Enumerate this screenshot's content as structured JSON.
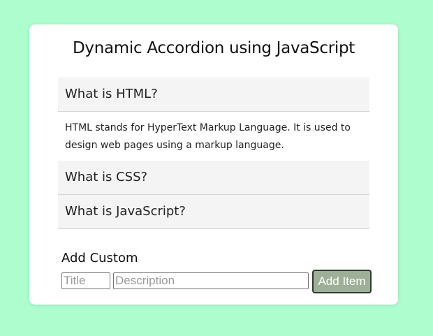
{
  "page": {
    "title": "Dynamic Accordion using JavaScript"
  },
  "accordion": {
    "items": [
      {
        "title": "What is HTML?",
        "body": "HTML stands for HyperText Markup Language. It is used to design web pages using a markup language.",
        "expanded": true
      },
      {
        "title": "What is CSS?",
        "expanded": false
      },
      {
        "title": "What is JavaScript?",
        "expanded": false
      }
    ]
  },
  "custom": {
    "heading": "Add Custom",
    "title_placeholder": "Title",
    "title_value": "",
    "description_placeholder": "Description",
    "description_value": "",
    "button_label": "Add Item"
  },
  "colors": {
    "background": "#adfdcf",
    "card": "#ffffff",
    "accordion_header": "#f4f4f4",
    "button": "#9db097"
  }
}
